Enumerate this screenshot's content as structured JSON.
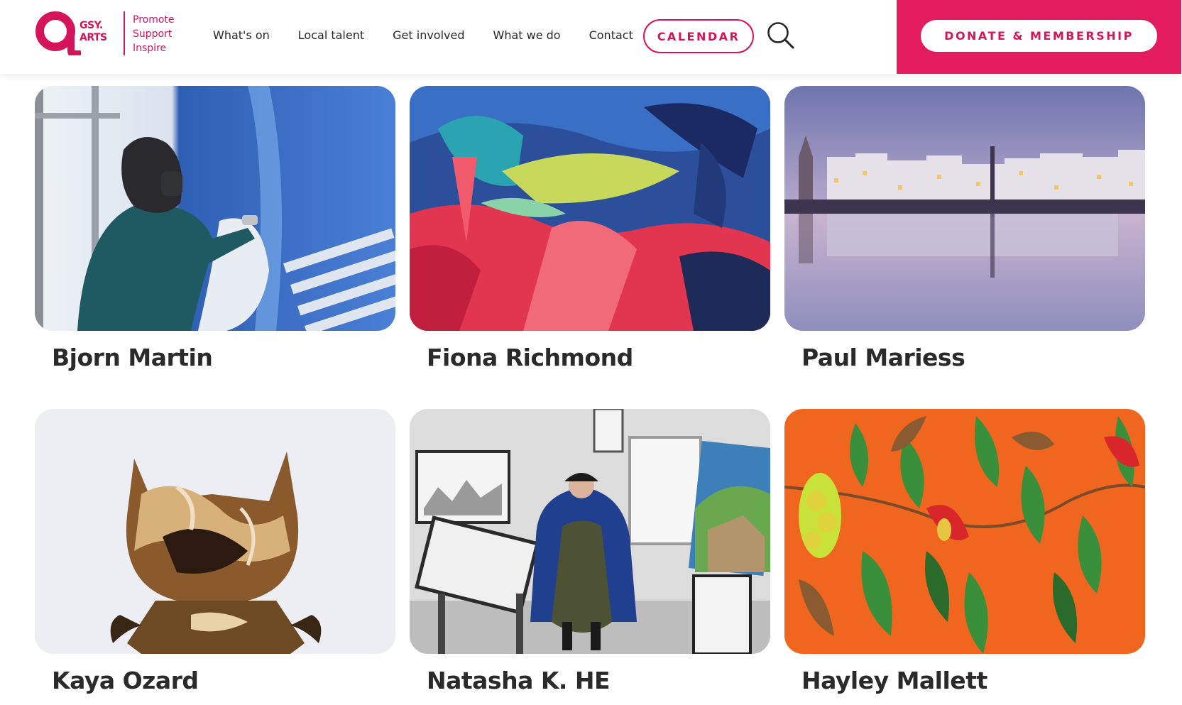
{
  "header": {
    "logo": {
      "wordmark_line1": "GSY.",
      "wordmark_line2": "ARTS",
      "tagline": [
        "Promote",
        "Support",
        "Inspire"
      ]
    },
    "nav": [
      "What's on",
      "Local talent",
      "Get involved",
      "What we do",
      "Contact"
    ],
    "calendar_label": "CALENDAR",
    "donate_label": "DONATE & MEMBERSHIP"
  },
  "talent": [
    {
      "name": "Bjorn Martin"
    },
    {
      "name": "Fiona Richmond"
    },
    {
      "name": "Paul Mariess"
    },
    {
      "name": "Kaya Ozard"
    },
    {
      "name": "Natasha K. HE"
    },
    {
      "name": "Hayley Mallett"
    }
  ],
  "colors": {
    "brand": "#d6145c",
    "donate_panel": "#e31b5f",
    "text": "#262626"
  },
  "icons": {
    "search": "search-icon"
  }
}
